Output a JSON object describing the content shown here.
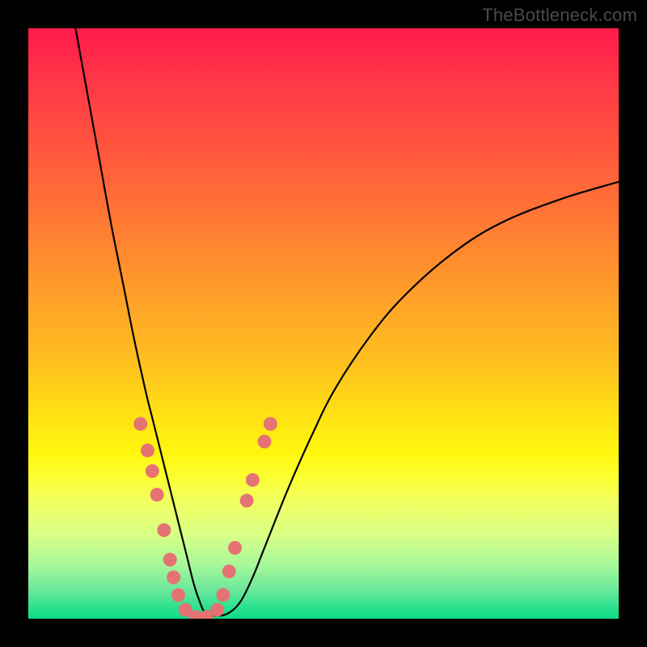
{
  "watermark": {
    "text": "TheBottleneck.com"
  },
  "colors": {
    "frame": "#000000",
    "curve_stroke": "#000000",
    "dot_fill": "#e57373",
    "dot_stroke": "#c24a4a"
  },
  "chart_data": {
    "type": "line",
    "title": "",
    "xlabel": "",
    "ylabel": "",
    "xlim": [
      0,
      100
    ],
    "ylim": [
      0,
      100
    ],
    "grid": false,
    "legend": false,
    "series": [
      {
        "name": "bottleneck-curve",
        "x": [
          8,
          10,
          12,
          14,
          16,
          18,
          20,
          21,
          22,
          23,
          24,
          25,
          26,
          27,
          28,
          29,
          30,
          32,
          34,
          36,
          38,
          40,
          44,
          48,
          52,
          58,
          64,
          72,
          80,
          90,
          100
        ],
        "y": [
          100,
          89,
          78,
          67,
          57,
          47,
          38,
          34,
          30,
          26,
          22,
          18,
          14,
          10,
          6,
          3,
          1,
          0.5,
          1,
          3,
          7,
          12,
          22,
          31,
          39,
          48,
          55,
          62,
          67,
          71,
          74
        ]
      }
    ],
    "scatter_overlay": {
      "name": "highlighted-points",
      "points_xy": [
        [
          19.0,
          33.0
        ],
        [
          20.2,
          28.5
        ],
        [
          21.0,
          25.0
        ],
        [
          21.8,
          21.0
        ],
        [
          23.0,
          15.0
        ],
        [
          24.0,
          10.0
        ],
        [
          24.6,
          7.0
        ],
        [
          25.4,
          4.0
        ],
        [
          26.6,
          1.5
        ],
        [
          28.3,
          0.3
        ],
        [
          30.2,
          0.3
        ],
        [
          32.0,
          1.5
        ],
        [
          33.0,
          4.0
        ],
        [
          34.0,
          8.0
        ],
        [
          35.0,
          12.0
        ],
        [
          37.0,
          20.0
        ],
        [
          38.0,
          23.5
        ],
        [
          40.0,
          30.0
        ],
        [
          41.0,
          33.0
        ]
      ]
    }
  }
}
